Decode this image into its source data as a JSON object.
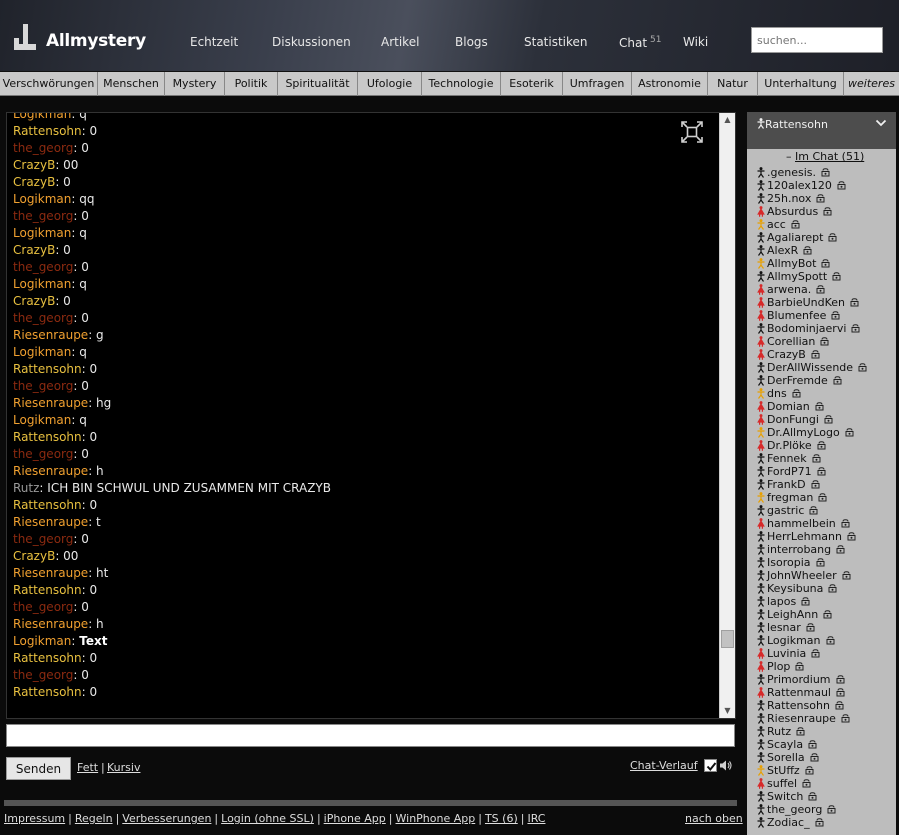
{
  "header": {
    "logo": "Allmystery",
    "nav": [
      {
        "label": "Echtzeit"
      },
      {
        "label": "Diskussionen"
      },
      {
        "label": "Artikel"
      },
      {
        "label": "Blogs"
      },
      {
        "label": "Statistiken"
      },
      {
        "label": "Chat",
        "badge": "51"
      },
      {
        "label": "Wiki"
      }
    ],
    "search_placeholder": "suchen..."
  },
  "categories": [
    "Verschwörungen",
    "Menschen",
    "Mystery",
    "Politik",
    "Spiritualität",
    "Ufologie",
    "Technologie",
    "Esoterik",
    "Umfragen",
    "Astronomie",
    "Natur",
    "Unterhaltung",
    "weiteres"
  ],
  "colors": {
    "Logikman": "#f0a030",
    "Rattensohn": "#e8c040",
    "the_georg": "#8b2a10",
    "CrazyB": "#e8c040",
    "Riesenraupe": "#f0a030",
    "Rutz": "#9a9a9a",
    "male_icon": "#111111",
    "female_icon": "#d62a2a",
    "mod_icon": "#e8a000"
  },
  "chat": {
    "messages": [
      {
        "user": "Logikman",
        "text": "q"
      },
      {
        "user": "Rattensohn",
        "text": "0"
      },
      {
        "user": "the_georg",
        "text": "0"
      },
      {
        "user": "CrazyB",
        "text": "00"
      },
      {
        "user": "CrazyB",
        "text": "0"
      },
      {
        "user": "Logikman",
        "text": "qq"
      },
      {
        "user": "the_georg",
        "text": "0"
      },
      {
        "user": "Logikman",
        "text": "q"
      },
      {
        "user": "CrazyB",
        "text": "0"
      },
      {
        "user": "the_georg",
        "text": "0"
      },
      {
        "user": "Logikman",
        "text": "q"
      },
      {
        "user": "CrazyB",
        "text": "0"
      },
      {
        "user": "the_georg",
        "text": "0"
      },
      {
        "user": "Riesenraupe",
        "text": "g"
      },
      {
        "user": "Logikman",
        "text": "q"
      },
      {
        "user": "Rattensohn",
        "text": "0"
      },
      {
        "user": "the_georg",
        "text": "0"
      },
      {
        "user": "Riesenraupe",
        "text": "hg"
      },
      {
        "user": "Logikman",
        "text": "q"
      },
      {
        "user": "Rattensohn",
        "text": "0"
      },
      {
        "user": "the_georg",
        "text": "0"
      },
      {
        "user": "Riesenraupe",
        "text": "h"
      },
      {
        "user": "Rutz",
        "text": "ICH BIN SCHWUL UND ZUSAMMEN MIT CRAZYB"
      },
      {
        "user": "Rattensohn",
        "text": "0"
      },
      {
        "user": "Riesenraupe",
        "text": "t"
      },
      {
        "user": "the_georg",
        "text": "0"
      },
      {
        "user": "CrazyB",
        "text": "00"
      },
      {
        "user": "Riesenraupe",
        "text": "ht"
      },
      {
        "user": "Rattensohn",
        "text": "0"
      },
      {
        "user": "the_georg",
        "text": "0"
      },
      {
        "user": "Riesenraupe",
        "text": "h"
      },
      {
        "user": "Logikman",
        "text": "Text",
        "bold": true
      },
      {
        "user": "Rattensohn",
        "text": "0"
      },
      {
        "user": "the_georg",
        "text": "0"
      },
      {
        "user": "Rattensohn",
        "text": "0"
      }
    ],
    "send_label": "Senden",
    "bold_label": "Fett",
    "italic_label": "Kursiv",
    "separator": "|",
    "history_label": "Chat-Verlauf",
    "autoscroll_checked": true
  },
  "sidebar": {
    "current_user": "Rattensohn",
    "im_chat_prefix": "–",
    "im_chat_label": "Im Chat (51)",
    "users": [
      {
        "name": ".genesis.",
        "g": "m"
      },
      {
        "name": "120alex120",
        "g": "m"
      },
      {
        "name": "25h.nox",
        "g": "m"
      },
      {
        "name": "Absurdus",
        "g": "f"
      },
      {
        "name": "acc",
        "g": "o"
      },
      {
        "name": "Agaliarept",
        "g": "m"
      },
      {
        "name": "AlexR",
        "g": "m"
      },
      {
        "name": "AllmyBot",
        "g": "o"
      },
      {
        "name": "AllmySpott",
        "g": "m"
      },
      {
        "name": "arwena.",
        "g": "f"
      },
      {
        "name": "BarbieUndKen",
        "g": "f"
      },
      {
        "name": "Blumenfee",
        "g": "f"
      },
      {
        "name": "Bodominjaervi",
        "g": "m"
      },
      {
        "name": "Corellian",
        "g": "f"
      },
      {
        "name": "CrazyB",
        "g": "f"
      },
      {
        "name": "DerAllWissende",
        "g": "m"
      },
      {
        "name": "DerFremde",
        "g": "m"
      },
      {
        "name": "dns",
        "g": "o"
      },
      {
        "name": "Domian",
        "g": "f"
      },
      {
        "name": "DonFungi",
        "g": "f"
      },
      {
        "name": "Dr.AllmyLogo",
        "g": "o"
      },
      {
        "name": "Dr.Plöke",
        "g": "f"
      },
      {
        "name": "Fennek",
        "g": "m"
      },
      {
        "name": "FordP71",
        "g": "m"
      },
      {
        "name": "FrankD",
        "g": "m"
      },
      {
        "name": "fregman",
        "g": "o"
      },
      {
        "name": "gastric",
        "g": "m"
      },
      {
        "name": "hammelbein",
        "g": "f"
      },
      {
        "name": "HerrLehmann",
        "g": "m"
      },
      {
        "name": "interrobang",
        "g": "m"
      },
      {
        "name": "Isoropia",
        "g": "m"
      },
      {
        "name": "JohnWheeler",
        "g": "m"
      },
      {
        "name": "Keysibuna",
        "g": "m"
      },
      {
        "name": "lapos",
        "g": "m"
      },
      {
        "name": "LeighAnn",
        "g": "m"
      },
      {
        "name": "lesnar",
        "g": "m"
      },
      {
        "name": "Logikman",
        "g": "m"
      },
      {
        "name": "Luvinia",
        "g": "f"
      },
      {
        "name": "Plop",
        "g": "f"
      },
      {
        "name": "Primordium",
        "g": "m"
      },
      {
        "name": "Rattenmaul",
        "g": "f"
      },
      {
        "name": "Rattensohn",
        "g": "m"
      },
      {
        "name": "Riesenraupe",
        "g": "m"
      },
      {
        "name": "Rutz",
        "g": "m"
      },
      {
        "name": "Scayla",
        "g": "m"
      },
      {
        "name": "Sorella",
        "g": "m"
      },
      {
        "name": "StUffz",
        "g": "o"
      },
      {
        "name": "suffel",
        "g": "f"
      },
      {
        "name": "Switch",
        "g": "m"
      },
      {
        "name": "the_georg",
        "g": "m"
      },
      {
        "name": "Zodiac_",
        "g": "m"
      }
    ]
  },
  "footer": {
    "links": [
      "Impressum",
      "Regeln",
      "Verbesserungen",
      "Login (ohne SSL)",
      "iPhone App",
      "WinPhone App",
      "TS (6)",
      "IRC"
    ],
    "back_to_top": "nach oben"
  }
}
